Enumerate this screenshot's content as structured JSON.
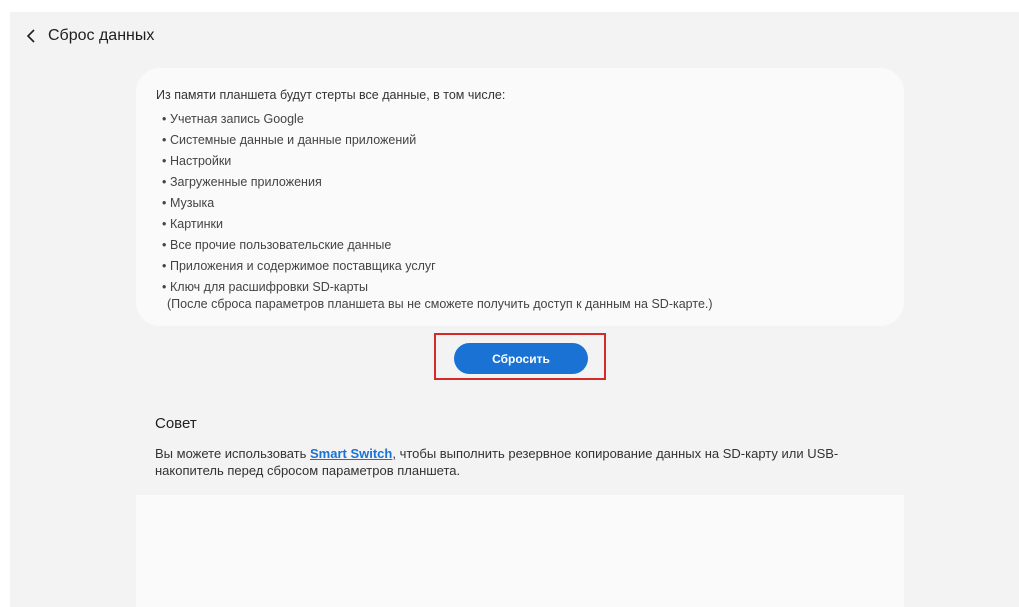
{
  "header": {
    "back_icon": "chevron-left-icon",
    "title": "Сброс данных"
  },
  "info": {
    "intro": "Из памяти планшета будут стерты все данные, в том числе:",
    "items": [
      "Учетная запись Google",
      "Системные данные и данные приложений",
      "Настройки",
      "Загруженные приложения",
      "Музыка",
      "Картинки",
      "Все прочие пользовательские данные",
      "Приложения и содержимое поставщика услуг",
      "Ключ для расшифровки SD-карты"
    ],
    "note": "(После сброса параметров планшета вы не сможете получить доступ к данным на SD-карте.)"
  },
  "actions": {
    "reset_label": "Сбросить"
  },
  "tip": {
    "title": "Совет",
    "text_before": "Вы можете использовать ",
    "link_label": "Smart Switch",
    "text_after": ", чтобы выполнить резервное копирование данных на SD-карту или USB-накопитель перед сбросом параметров планшета."
  },
  "colors": {
    "accent": "#1a73d4",
    "highlight": "#d42a2a",
    "background": "#f3f3f3",
    "card": "#fafafa"
  }
}
